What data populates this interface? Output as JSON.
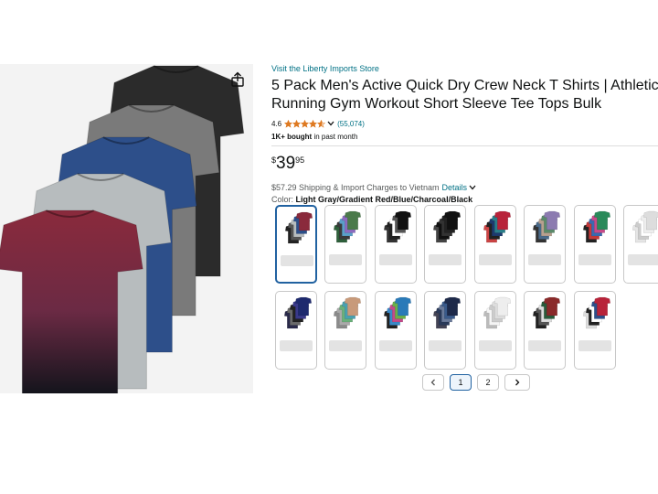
{
  "product": {
    "store_link": "Visit the Liberty Imports Store",
    "title_line1": "5 Pack Men's Active Quick Dry Crew Neck T Shirts | Athletic",
    "title_line2": "Running Gym Workout Short Sleeve Tee Tops Bulk",
    "rating_value": "4.6",
    "rating_stars": 4.6,
    "review_count": "(55,074)",
    "bought_bold": "1K+ bought",
    "bought_rest": " in past month",
    "price_currency": "$",
    "price_whole": "39",
    "price_fraction": "95",
    "shipping_text": "$57.29 Shipping & Import Charges to Vietnam",
    "details_link": "Details",
    "color_label": "Color:",
    "color_value": "Light Gray/Gradient Red/Blue/Charcoal/Black"
  },
  "gallery": {
    "share_icon": "share-icon",
    "shirt_colors": [
      "#2b2b2b",
      "#7a7a7a",
      "#2d4f8a",
      "#b7bcbe",
      "#8a2a3c"
    ]
  },
  "swatches": [
    {
      "colors": [
        "#8a2a3c",
        "#2d4f8a",
        "#b7bcbe",
        "#555",
        "#222"
      ],
      "selected": true
    },
    {
      "colors": [
        "#4a7a4a",
        "#8c6bbf",
        "#5aa0c8",
        "#3a3a3a",
        "#2e5f3a"
      ],
      "selected": false
    },
    {
      "colors": [
        "#111",
        "#555",
        "#fff",
        "#222",
        "#333"
      ],
      "selected": false
    },
    {
      "colors": [
        "#111",
        "#222",
        "#333",
        "#111",
        "#444"
      ],
      "selected": false
    },
    {
      "colors": [
        "#b8233a",
        "#2a7f8a",
        "#1e3a6e",
        "#222",
        "#c44"
      ],
      "selected": false
    },
    {
      "colors": [
        "#8c7bb0",
        "#5a8a6a",
        "#b8a090",
        "#4a6a8a",
        "#333"
      ],
      "selected": false
    },
    {
      "colors": [
        "#2a8a5a",
        "#c84a8a",
        "#3a6ab0",
        "#c43a3a",
        "#222"
      ],
      "selected": false
    },
    {
      "colors": [
        "#ddd",
        "#eee",
        "#fff",
        "#ccc",
        "#e5e5e5"
      ],
      "selected": false
    },
    {
      "colors": [
        "#1e2a6e",
        "#3a3a8a",
        "#222",
        "#6a6a6a",
        "#2a2a4a"
      ],
      "selected": false
    },
    {
      "colors": [
        "#c89a7a",
        "#4aa0b0",
        "#6ab07a",
        "#aaa",
        "#8a8a8a"
      ],
      "selected": false
    },
    {
      "colors": [
        "#2a7ab8",
        "#6ab04a",
        "#c44a8a",
        "#3a8ac8",
        "#222"
      ],
      "selected": false
    },
    {
      "colors": [
        "#1e2a4a",
        "#3a5a8a",
        "#6a7a9a",
        "#2a3a5a",
        "#445"
      ],
      "selected": false
    },
    {
      "colors": [
        "#eee",
        "#ddd",
        "#ccc",
        "#f5f5f5",
        "#bbb"
      ],
      "selected": false
    },
    {
      "colors": [
        "#8a2a2a",
        "#2a5a3a",
        "#ddd",
        "#555",
        "#222"
      ],
      "selected": false
    },
    {
      "colors": [
        "#b8233a",
        "#2d4f8a",
        "#fff",
        "#222",
        "#ddd"
      ],
      "selected": false
    }
  ],
  "pager": {
    "prev_icon": "chevron-left-icon",
    "page1": "1",
    "page2": "2",
    "next_icon": "chevron-right-icon"
  }
}
